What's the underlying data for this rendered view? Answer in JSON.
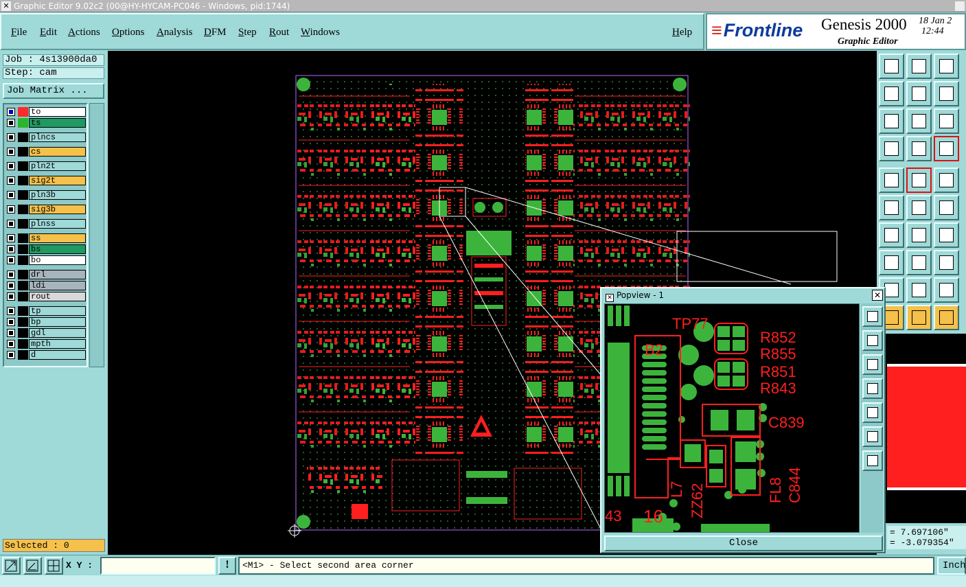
{
  "window": {
    "title": "Graphic Editor 9.02c2 (00@HY-HYCAM-PC046 - Windows, pid:1744)"
  },
  "menu": {
    "items": [
      "File",
      "Edit",
      "Actions",
      "Options",
      "Analysis",
      "DFM",
      "Step",
      "Rout",
      "Windows"
    ],
    "help": "Help"
  },
  "brand": {
    "logo": "Frontline",
    "product": "Genesis 2000",
    "subtitle": "Graphic Editor",
    "date": "18 Jan 2",
    "time": "12:44"
  },
  "job": {
    "job_label": "Job : 4s13900da0",
    "step_label": "Step: cam",
    "matrix_button": "Job Matrix ..."
  },
  "layers": [
    {
      "name": "to",
      "color": "#ffffff",
      "swatch": "#ff2a2a",
      "active": true
    },
    {
      "name": "ts",
      "color": "#1f9a63",
      "swatch": "#2bb52b"
    },
    {
      "name": "plncs",
      "color": "#9fd9d8",
      "swatch": "#000000"
    },
    {
      "name": "cs",
      "color": "#f5c14a",
      "swatch": "#000000"
    },
    {
      "name": "pln2t",
      "color": "#9fd9d8",
      "swatch": "#000000"
    },
    {
      "name": "sig2t",
      "color": "#f5c14a",
      "swatch": "#000000"
    },
    {
      "name": "pln3b",
      "color": "#9fd9d8",
      "swatch": "#000000"
    },
    {
      "name": "sig3b",
      "color": "#f5c14a",
      "swatch": "#000000"
    },
    {
      "name": "plnss",
      "color": "#9fd9d8",
      "swatch": "#000000"
    },
    {
      "name": "ss",
      "color": "#f5c14a",
      "swatch": "#000000"
    },
    {
      "name": "bs",
      "color": "#1f9a63",
      "swatch": "#000000"
    },
    {
      "name": "bo",
      "color": "#ffffff",
      "swatch": "#000000"
    },
    {
      "name": "drl",
      "color": "#a8b4bc",
      "swatch": "#000000"
    },
    {
      "name": "ldi",
      "color": "#a8b4bc",
      "swatch": "#000000"
    },
    {
      "name": "rout",
      "color": "#d8d8d8",
      "swatch": "#000000"
    },
    {
      "name": "tp",
      "color": "#9fd9d8",
      "swatch": "#000000"
    },
    {
      "name": "bp",
      "color": "#9fd9d8",
      "swatch": "#000000"
    },
    {
      "name": "gdl",
      "color": "#9fd9d8",
      "swatch": "#000000"
    },
    {
      "name": "mpth",
      "color": "#9fd9d8",
      "swatch": "#000000"
    },
    {
      "name": "d",
      "color": "#9fd9d8",
      "swatch": "#000000"
    }
  ],
  "selection": {
    "label": "Selected : 0"
  },
  "coords": {
    "x": "= 7.697106\"",
    "y": "= -3.079354\""
  },
  "bottom": {
    "xy_label": "X Y :",
    "xy_value": "",
    "status": "<M1> - Select second area corner",
    "units": "Inch"
  },
  "popview": {
    "title": "Popview - 1",
    "close_button": "Close",
    "labels": [
      "TP77",
      "R852",
      "R855",
      "R851",
      "R843",
      "C839",
      "FL8",
      "C844",
      "ZZ62",
      "L7",
      "B2",
      "16",
      "43"
    ]
  },
  "colors": {
    "board_red": "#ff1f1f",
    "board_green": "#3cb43c",
    "panel": "#9fd9d8"
  }
}
